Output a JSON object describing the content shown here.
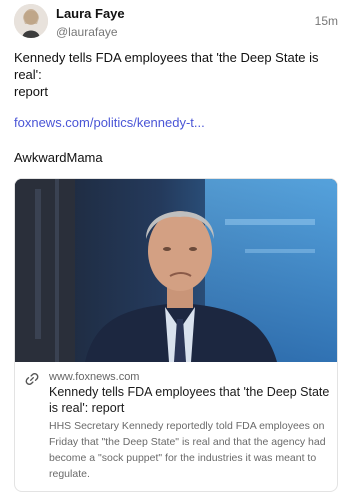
{
  "author": {
    "name": "Laura Faye",
    "handle": "@laurafaye",
    "time": "15m"
  },
  "post": {
    "text_lines": [
      "Kennedy tells FDA employees that 'the Deep State is",
      "real':",
      "report"
    ],
    "link": "foxnews.com/politics/kennedy-t...",
    "signature": "AwkwardMama"
  },
  "card": {
    "domain": "www.foxnews.com",
    "title": "Kennedy tells FDA employees that 'the Deep State is real': report",
    "description": "HHS Secretary Kennedy reportedly told FDA employees on Friday that \"the Deep State\" is real and that the agency had become a \"sock puppet\" for the industries it was meant to regulate."
  },
  "colors": {
    "link": "#4a55d6",
    "muted": "#777777"
  },
  "icons": {
    "card_link": "link-icon"
  }
}
